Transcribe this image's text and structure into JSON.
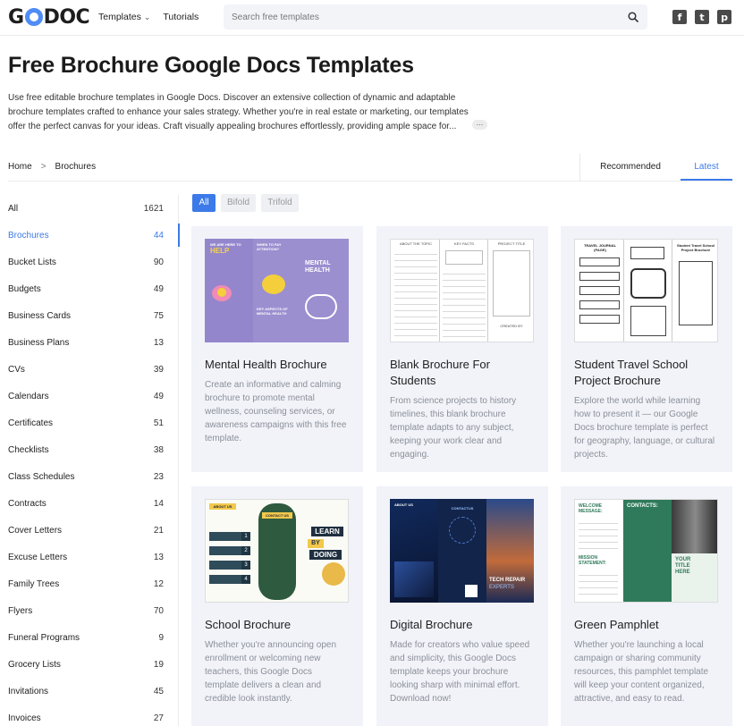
{
  "header": {
    "logo": "GDOC",
    "nav": [
      {
        "label": "Templates",
        "has_dropdown": true
      },
      {
        "label": "Tutorials",
        "has_dropdown": false
      }
    ],
    "search_placeholder": "Search free templates",
    "social": [
      "facebook-icon",
      "twitter-icon",
      "pinterest-icon"
    ]
  },
  "hero": {
    "title": "Free Brochure Google Docs Templates",
    "intro_lines": [
      "Use free editable brochure templates in Google Docs. Discover an extensive collection of dynamic and adaptable",
      "brochure templates crafted to enhance your sales strategy. Whether you're in real estate or marketing, our templates",
      "offer the perfect canvas for your ideas. Craft visually appealing brochures effortlessly, providing ample space for..."
    ],
    "more": "..."
  },
  "breadcrumb": {
    "home": "Home",
    "sep": ">",
    "current": "Brochures"
  },
  "sort": {
    "recommended": "Recommended",
    "latest": "Latest",
    "active": "Latest"
  },
  "sidebar": {
    "items": [
      {
        "label": "All",
        "count": "1621"
      },
      {
        "label": "Brochures",
        "count": "44",
        "active": true
      },
      {
        "label": "Bucket Lists",
        "count": "90"
      },
      {
        "label": "Budgets",
        "count": "49"
      },
      {
        "label": "Business Cards",
        "count": "75"
      },
      {
        "label": "Business Plans",
        "count": "13"
      },
      {
        "label": "CVs",
        "count": "39"
      },
      {
        "label": "Calendars",
        "count": "49"
      },
      {
        "label": "Certificates",
        "count": "51"
      },
      {
        "label": "Checklists",
        "count": "38"
      },
      {
        "label": "Class Schedules",
        "count": "23"
      },
      {
        "label": "Contracts",
        "count": "14"
      },
      {
        "label": "Cover Letters",
        "count": "21"
      },
      {
        "label": "Excuse Letters",
        "count": "13"
      },
      {
        "label": "Family Trees",
        "count": "12"
      },
      {
        "label": "Flyers",
        "count": "70"
      },
      {
        "label": "Funeral Programs",
        "count": "9"
      },
      {
        "label": "Grocery Lists",
        "count": "19"
      },
      {
        "label": "Invitations",
        "count": "45"
      },
      {
        "label": "Invoices",
        "count": "27"
      }
    ]
  },
  "filters": {
    "all": "All",
    "bifold": "Bifold",
    "trifold": "Trifold",
    "active": "All"
  },
  "cards": [
    {
      "title": "Mental Health Brochure",
      "desc": [
        "Create an informative and calming",
        "brochure to promote mental",
        "wellness, counseling services, or",
        "awareness campaigns with this free",
        "template."
      ],
      "thumb": {
        "a": "WE ARE HERE TO",
        "b": "HELP",
        "c": "WHEN TO PAY ATTENTION?",
        "d": "MENTAL HEALTH",
        "e": "KEY ASPECTS OF MENTAL HEALTH"
      }
    },
    {
      "title": "Blank Brochure For Students",
      "desc": [
        "From science projects to history",
        "timelines, this blank brochure",
        "template adapts to any subject,",
        "keeping your work clear and",
        "engaging."
      ],
      "thumb": {
        "a": "ABOUT THE TOPIC",
        "b": "KEY FACTS",
        "c": "PROJECT TITLE",
        "d": "CREATED BY"
      }
    },
    {
      "title": "Student Travel School Project Brochure",
      "desc": [
        "Explore the world while learning",
        "how to present it — our Google",
        "Docs brochure template is perfect",
        "for geography, language, or cultural",
        "projects."
      ],
      "thumb": {
        "a": "TRAVEL JOURNAL (PAGE)",
        "b": "Student Travel School Project Brochure"
      }
    },
    {
      "title": "School Brochure",
      "desc": [
        "Whether you're announcing open",
        "enrollment or welcoming new",
        "teachers, this Google Docs",
        "template delivers a clean and",
        "credible look instantly."
      ],
      "thumb": {
        "a": "ABOUT US",
        "b": "CONTACT US",
        "c": "LEARN",
        "d": "BY",
        "e": "DOING",
        "f": "1",
        "g": "2",
        "h": "3",
        "i": "4"
      }
    },
    {
      "title": "Digital Brochure",
      "desc": [
        "Made for creators who value speed",
        "and simplicity, this Google Docs",
        "template keeps your brochure",
        "looking sharp with minimal effort.",
        "Download now!"
      ],
      "thumb": {
        "a": "ABOUT US",
        "b": "CONTACTUS",
        "c": "TECH REPAIR",
        "d": "EXPERTS"
      }
    },
    {
      "title": "Green Pamphlet",
      "desc": [
        "Whether you're launching a local",
        "campaign or sharing community",
        "resources, this pamphlet template",
        "will keep your content organized,",
        "attractive, and easy to read."
      ],
      "thumb": {
        "a": "WELCOME MESSAGE:",
        "b": "CONTACTS:",
        "c": "MISSION STATEMENT:",
        "d": "YOUR TITLE HERE"
      }
    }
  ],
  "colors": {
    "accent": "#3b7ae8",
    "card_bg": "#f1f3f9",
    "brand_o": "#4f8cf5"
  }
}
